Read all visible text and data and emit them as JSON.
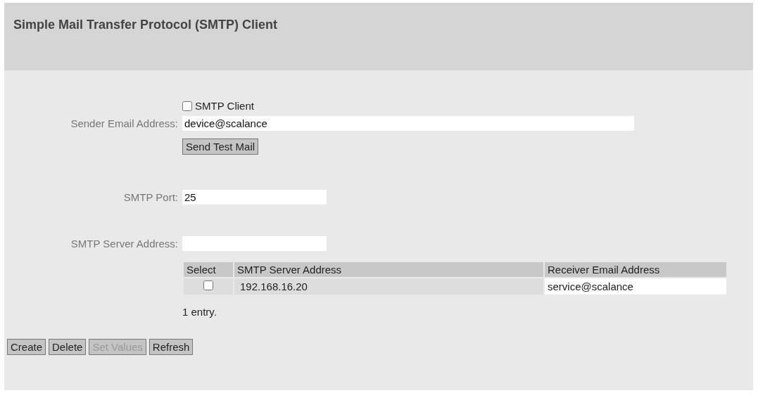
{
  "header": {
    "title": "Simple Mail Transfer Protocol (SMTP) Client"
  },
  "smtp_client": {
    "label": "SMTP Client",
    "checked": false
  },
  "sender_email": {
    "label": "Sender Email Address:",
    "value": "device@scalance"
  },
  "send_test_mail": {
    "label": "Send Test Mail"
  },
  "smtp_port": {
    "label": "SMTP Port:",
    "value": "25"
  },
  "smtp_server": {
    "label": "SMTP Server Address:"
  },
  "table": {
    "columns": [
      "Select",
      "SMTP Server Address",
      "Receiver Email Address"
    ],
    "rows": [
      {
        "selected": false,
        "server": "192.168.16.20",
        "receiver": "service@scalance"
      }
    ]
  },
  "entry_count": "1 entry.",
  "buttons": [
    {
      "label": "Create",
      "disabled": false
    },
    {
      "label": "Delete",
      "disabled": false
    },
    {
      "label": "Set Values",
      "disabled": true
    },
    {
      "label": "Refresh",
      "disabled": false
    }
  ]
}
